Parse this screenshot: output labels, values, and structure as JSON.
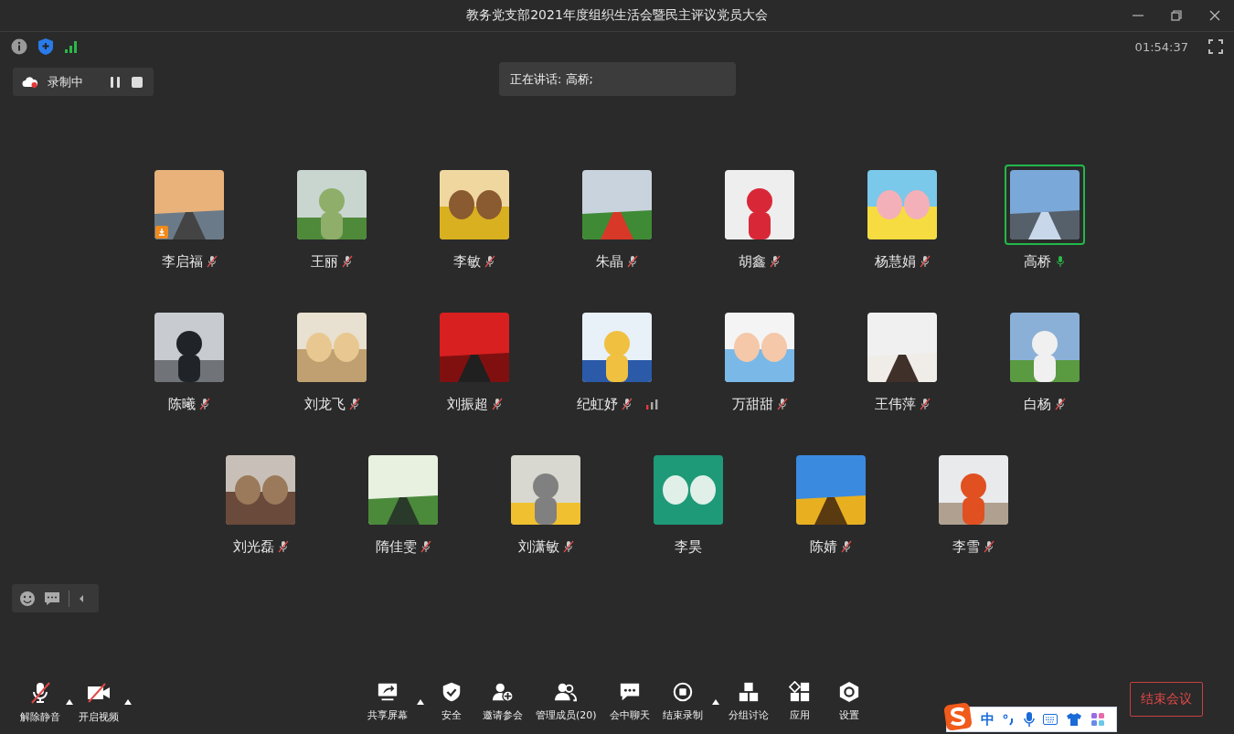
{
  "window": {
    "title": "教务党支部2021年度组织生活会暨民主评议党员大会"
  },
  "meeting_timer": "01:54:37",
  "recording": {
    "label": "录制中"
  },
  "speaker_banner": "正在讲话: 高桥;",
  "participant_rows": [
    [
      {
        "name": "李启福",
        "muted": true,
        "speaking": false,
        "badge": true,
        "signal": false
      },
      {
        "name": "王丽",
        "muted": true,
        "speaking": false,
        "badge": false,
        "signal": false
      },
      {
        "name": "李敏",
        "muted": true,
        "speaking": false,
        "badge": false,
        "signal": false
      },
      {
        "name": "朱晶",
        "muted": true,
        "speaking": false,
        "badge": false,
        "signal": false
      },
      {
        "name": "胡鑫",
        "muted": true,
        "speaking": false,
        "badge": false,
        "signal": false
      },
      {
        "name": "杨慧娟",
        "muted": true,
        "speaking": false,
        "badge": false,
        "signal": false
      },
      {
        "name": "高桥",
        "muted": false,
        "speaking": true,
        "badge": false,
        "signal": false
      }
    ],
    [
      {
        "name": "陈曦",
        "muted": true,
        "speaking": false,
        "badge": false,
        "signal": false
      },
      {
        "name": "刘龙飞",
        "muted": true,
        "speaking": false,
        "badge": false,
        "signal": false
      },
      {
        "name": "刘振超",
        "muted": true,
        "speaking": false,
        "badge": false,
        "signal": false
      },
      {
        "name": "纪虹妤",
        "muted": true,
        "speaking": false,
        "badge": false,
        "signal": true
      },
      {
        "name": "万甜甜",
        "muted": true,
        "speaking": false,
        "badge": false,
        "signal": false
      },
      {
        "name": "王伟萍",
        "muted": true,
        "speaking": false,
        "badge": false,
        "signal": false
      },
      {
        "name": "白杨",
        "muted": true,
        "speaking": false,
        "badge": false,
        "signal": false
      }
    ],
    [
      {
        "name": "刘光磊",
        "muted": true,
        "speaking": false,
        "badge": false,
        "signal": false
      },
      {
        "name": "隋佳雯",
        "muted": true,
        "speaking": false,
        "badge": false,
        "signal": false
      },
      {
        "name": "刘潇敏",
        "muted": true,
        "speaking": false,
        "badge": false,
        "signal": false
      },
      {
        "name": "李昊",
        "muted": false,
        "speaking": false,
        "badge": false,
        "signal": false
      },
      {
        "name": "陈婧",
        "muted": true,
        "speaking": false,
        "badge": false,
        "signal": false
      },
      {
        "name": "李雪",
        "muted": true,
        "speaking": false,
        "badge": false,
        "signal": false
      }
    ]
  ],
  "toolbar_left": [
    {
      "kind": "mic-off",
      "label": "解除静音",
      "caret": true
    },
    {
      "kind": "video-off",
      "label": "开启视频",
      "caret": true
    }
  ],
  "toolbar_center": [
    {
      "kind": "share",
      "label": "共享屏幕",
      "caret": true
    },
    {
      "kind": "shield",
      "label": "安全",
      "caret": false
    },
    {
      "kind": "invite",
      "label": "邀请参会",
      "caret": false
    },
    {
      "kind": "members",
      "label": "管理成员(20)",
      "caret": false
    },
    {
      "kind": "chat",
      "label": "会中聊天",
      "caret": false
    },
    {
      "kind": "record-stop",
      "label": "结束录制",
      "caret": true
    },
    {
      "kind": "breakout",
      "label": "分组讨论",
      "caret": false
    },
    {
      "kind": "apps",
      "label": "应用",
      "caret": false
    },
    {
      "kind": "settings",
      "label": "设置",
      "caret": false
    }
  ],
  "end_button": "结束会议",
  "ime": {
    "mode": "中"
  }
}
